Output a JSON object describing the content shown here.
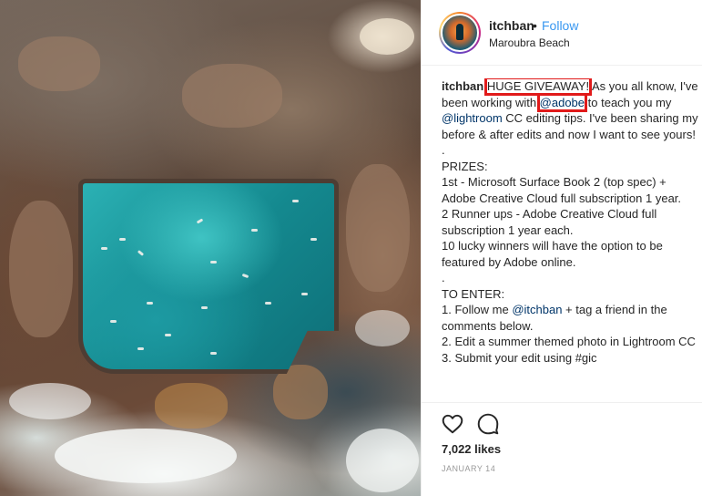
{
  "post": {
    "username": "itchban",
    "separator": "•",
    "follow_label": "Follow",
    "location": "Maroubra Beach"
  },
  "caption": {
    "user": "itchban",
    "giveaway": "HUGE GIVEAWAY!",
    "intro_a": " As you all know, I've been working with ",
    "adobe_mention": "@adobe",
    "intro_b": " to teach you my ",
    "lightroom_mention": "@lightroom",
    "intro_c": " CC editing tips. I've been sharing my before & after edits and now I want to see yours!",
    "body": ".\nPRIZES:\n1st - Microsoft Surface Book 2 (top spec) + Adobe Creative Cloud full subscription 1 year.\n2 Runner ups - Adobe Creative Cloud full subscription 1 year each.\n10 lucky winners will have the option to be featured by Adobe online.\n.\nTO ENTER:\n1. Follow me ",
    "itchban_mention": "@itchban",
    "body_b": " + tag a friend in the comments below.\n2. Edit a summer themed photo in Lightroom CC\n3. Submit your edit using #gic"
  },
  "icons": {
    "like": "heart-icon",
    "comment": "comment-icon"
  },
  "likes": "7,022 likes",
  "date": "JANUARY 14",
  "colors": {
    "link": "#3897f0",
    "mention": "#003569",
    "highlight": "#e11a1a"
  }
}
